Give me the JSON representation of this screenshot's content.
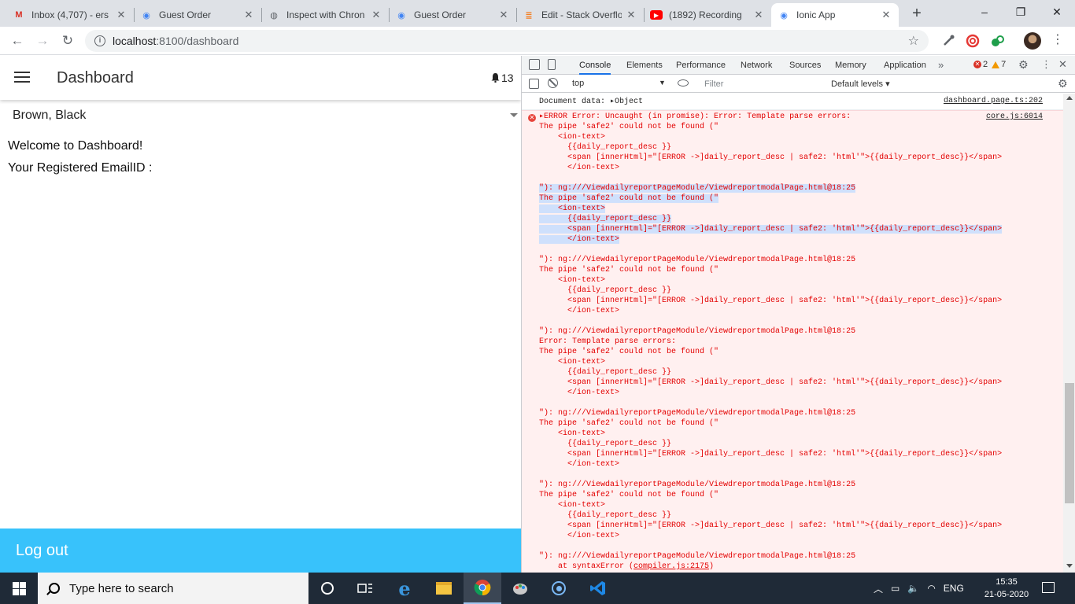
{
  "browser": {
    "tabs": [
      {
        "title": "Inbox (4,707) - ers",
        "icon": "gmail-icon"
      },
      {
        "title": "Guest Order",
        "icon": "ionic-icon"
      },
      {
        "title": "Inspect with Chron",
        "icon": "globe-icon"
      },
      {
        "title": "Guest Order",
        "icon": "ionic-icon"
      },
      {
        "title": "Edit - Stack Overflo",
        "icon": "stackoverflow-icon"
      },
      {
        "title": "(1892) Recording",
        "icon": "youtube-icon"
      },
      {
        "title": "Ionic App",
        "icon": "ionic-icon"
      }
    ],
    "new_tab": "+",
    "window_controls": {
      "minimize": "–",
      "restore": "❐",
      "close": "✕"
    },
    "url_host": "localhost",
    "url_rest": ":8100/dashboard"
  },
  "app": {
    "title": "Dashboard",
    "notification_count": "13",
    "select_value": "Brown, Black",
    "welcome_text": "Welcome to Dashboard!",
    "email_label": "Your Registered EmailID :",
    "logout_label": "Log out",
    "header_color": "#ffffff",
    "footer_color": "#38c2fb"
  },
  "devtools": {
    "tabs": [
      "Console",
      "Elements",
      "Performance",
      "Network",
      "Sources",
      "Memory",
      "Application"
    ],
    "active_tab": "Console",
    "error_count": "2",
    "warning_count": "7",
    "context": "top",
    "filter_placeholder": "Filter",
    "levels": "Default levels ▾",
    "info_log": {
      "message": "Document data: ▸Object",
      "source": "dashboard.page.ts:202"
    },
    "error_log": {
      "source": "core.js:6014",
      "lines": [
        {
          "text": "▸ERROR Error: Uncaught (in promise): Error: Template parse errors:"
        },
        {
          "text": "The pipe 'safe2' could not be found (\""
        },
        {
          "text": "    <ion-text>"
        },
        {
          "text": "      {{daily_report_desc }}"
        },
        {
          "text": "      <span [innerHtml]=\"[ERROR ->]daily_report_desc | safe2: 'html'\">{{daily_report_desc}}</span>"
        },
        {
          "text": "      </ion-text>"
        },
        {
          "text": ""
        },
        {
          "text": "\"): ng:///ViewdailyreportPageModule/ViewdreportmodalPage.html@18:25",
          "selected": true
        },
        {
          "text": "The pipe 'safe2' could not be found (\"",
          "selected": true
        },
        {
          "text": "    <ion-text>",
          "selected": true
        },
        {
          "text": "      {{daily_report_desc }}",
          "selected": true
        },
        {
          "text": "      <span [innerHtml]=\"[ERROR ->]daily_report_desc | safe2: 'html'\">{{daily_report_desc}}</span>",
          "selected": true
        },
        {
          "text": "      </ion-text>",
          "selected": true
        },
        {
          "text": ""
        },
        {
          "text": "\"): ng:///ViewdailyreportPageModule/ViewdreportmodalPage.html@18:25"
        },
        {
          "text": "The pipe 'safe2' could not be found (\""
        },
        {
          "text": "    <ion-text>"
        },
        {
          "text": "      {{daily_report_desc }}"
        },
        {
          "text": "      <span [innerHtml]=\"[ERROR ->]daily_report_desc | safe2: 'html'\">{{daily_report_desc}}</span>"
        },
        {
          "text": "      </ion-text>"
        },
        {
          "text": ""
        },
        {
          "text": "\"): ng:///ViewdailyreportPageModule/ViewdreportmodalPage.html@18:25"
        },
        {
          "text": "Error: Template parse errors:"
        },
        {
          "text": "The pipe 'safe2' could not be found (\""
        },
        {
          "text": "    <ion-text>"
        },
        {
          "text": "      {{daily_report_desc }}"
        },
        {
          "text": "      <span [innerHtml]=\"[ERROR ->]daily_report_desc | safe2: 'html'\">{{daily_report_desc}}</span>"
        },
        {
          "text": "      </ion-text>"
        },
        {
          "text": ""
        },
        {
          "text": "\"): ng:///ViewdailyreportPageModule/ViewdreportmodalPage.html@18:25"
        },
        {
          "text": "The pipe 'safe2' could not be found (\""
        },
        {
          "text": "    <ion-text>"
        },
        {
          "text": "      {{daily_report_desc }}"
        },
        {
          "text": "      <span [innerHtml]=\"[ERROR ->]daily_report_desc | safe2: 'html'\">{{daily_report_desc}}</span>"
        },
        {
          "text": "      </ion-text>"
        },
        {
          "text": ""
        },
        {
          "text": "\"): ng:///ViewdailyreportPageModule/ViewdreportmodalPage.html@18:25"
        },
        {
          "text": "The pipe 'safe2' could not be found (\""
        },
        {
          "text": "    <ion-text>"
        },
        {
          "text": "      {{daily_report_desc }}"
        },
        {
          "text": "      <span [innerHtml]=\"[ERROR ->]daily_report_desc | safe2: 'html'\">{{daily_report_desc}}</span>"
        },
        {
          "text": "      </ion-text>"
        },
        {
          "text": ""
        },
        {
          "text": "\"): ng:///ViewdailyreportPageModule/ViewdreportmodalPage.html@18:25"
        },
        {
          "text": "    at syntaxError (compiler.js:2175)"
        }
      ]
    },
    "error_color": "#e30000",
    "error_background": "#fff0f0"
  },
  "taskbar": {
    "search_placeholder": "Type here to search",
    "language": "ENG",
    "time": "15:35",
    "date": "21-05-2020",
    "apps": [
      "task-view-icon",
      "taskbar-manager-icon",
      "edge-icon",
      "file-explorer-icon",
      "chrome-icon",
      "paint-icon",
      "ionic-devapp-icon",
      "vscode-icon"
    ]
  }
}
